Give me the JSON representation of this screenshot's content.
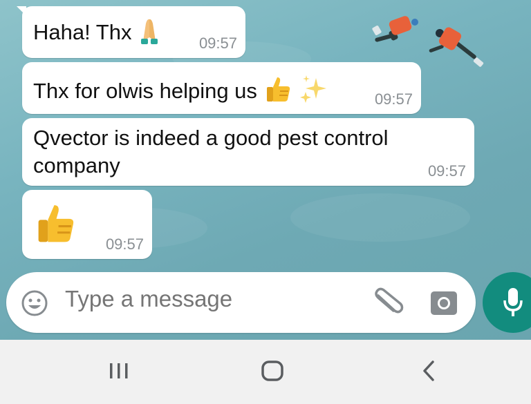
{
  "messages": [
    {
      "text": "Haha! Thx",
      "emoji": [
        "folded-hands-icon"
      ],
      "time": "09:57"
    },
    {
      "text": "Thx for olwis helping us",
      "emoji": [
        "thumbs-up-icon",
        "sparkles-icon"
      ],
      "time": "09:57"
    },
    {
      "lines": [
        "Qvector is indeed a good pest control",
        "company"
      ],
      "time": "09:57"
    },
    {
      "emoji": [
        "thumbs-up-icon"
      ],
      "time": "09:57"
    }
  ],
  "composer": {
    "placeholder": "Type a message",
    "icons": [
      "smiley-icon",
      "paperclip-icon",
      "camera-icon"
    ]
  },
  "mic_button": {
    "icon": "microphone-icon",
    "color": "#128c7e"
  },
  "navbar": {
    "icons": [
      "recent-apps-icon",
      "home-icon",
      "back-icon"
    ]
  },
  "colors": {
    "bubble": "#ffffff",
    "timestamp": "#8a8f93",
    "placeholder": "#b9bcbe",
    "accent": "#128c7e"
  }
}
